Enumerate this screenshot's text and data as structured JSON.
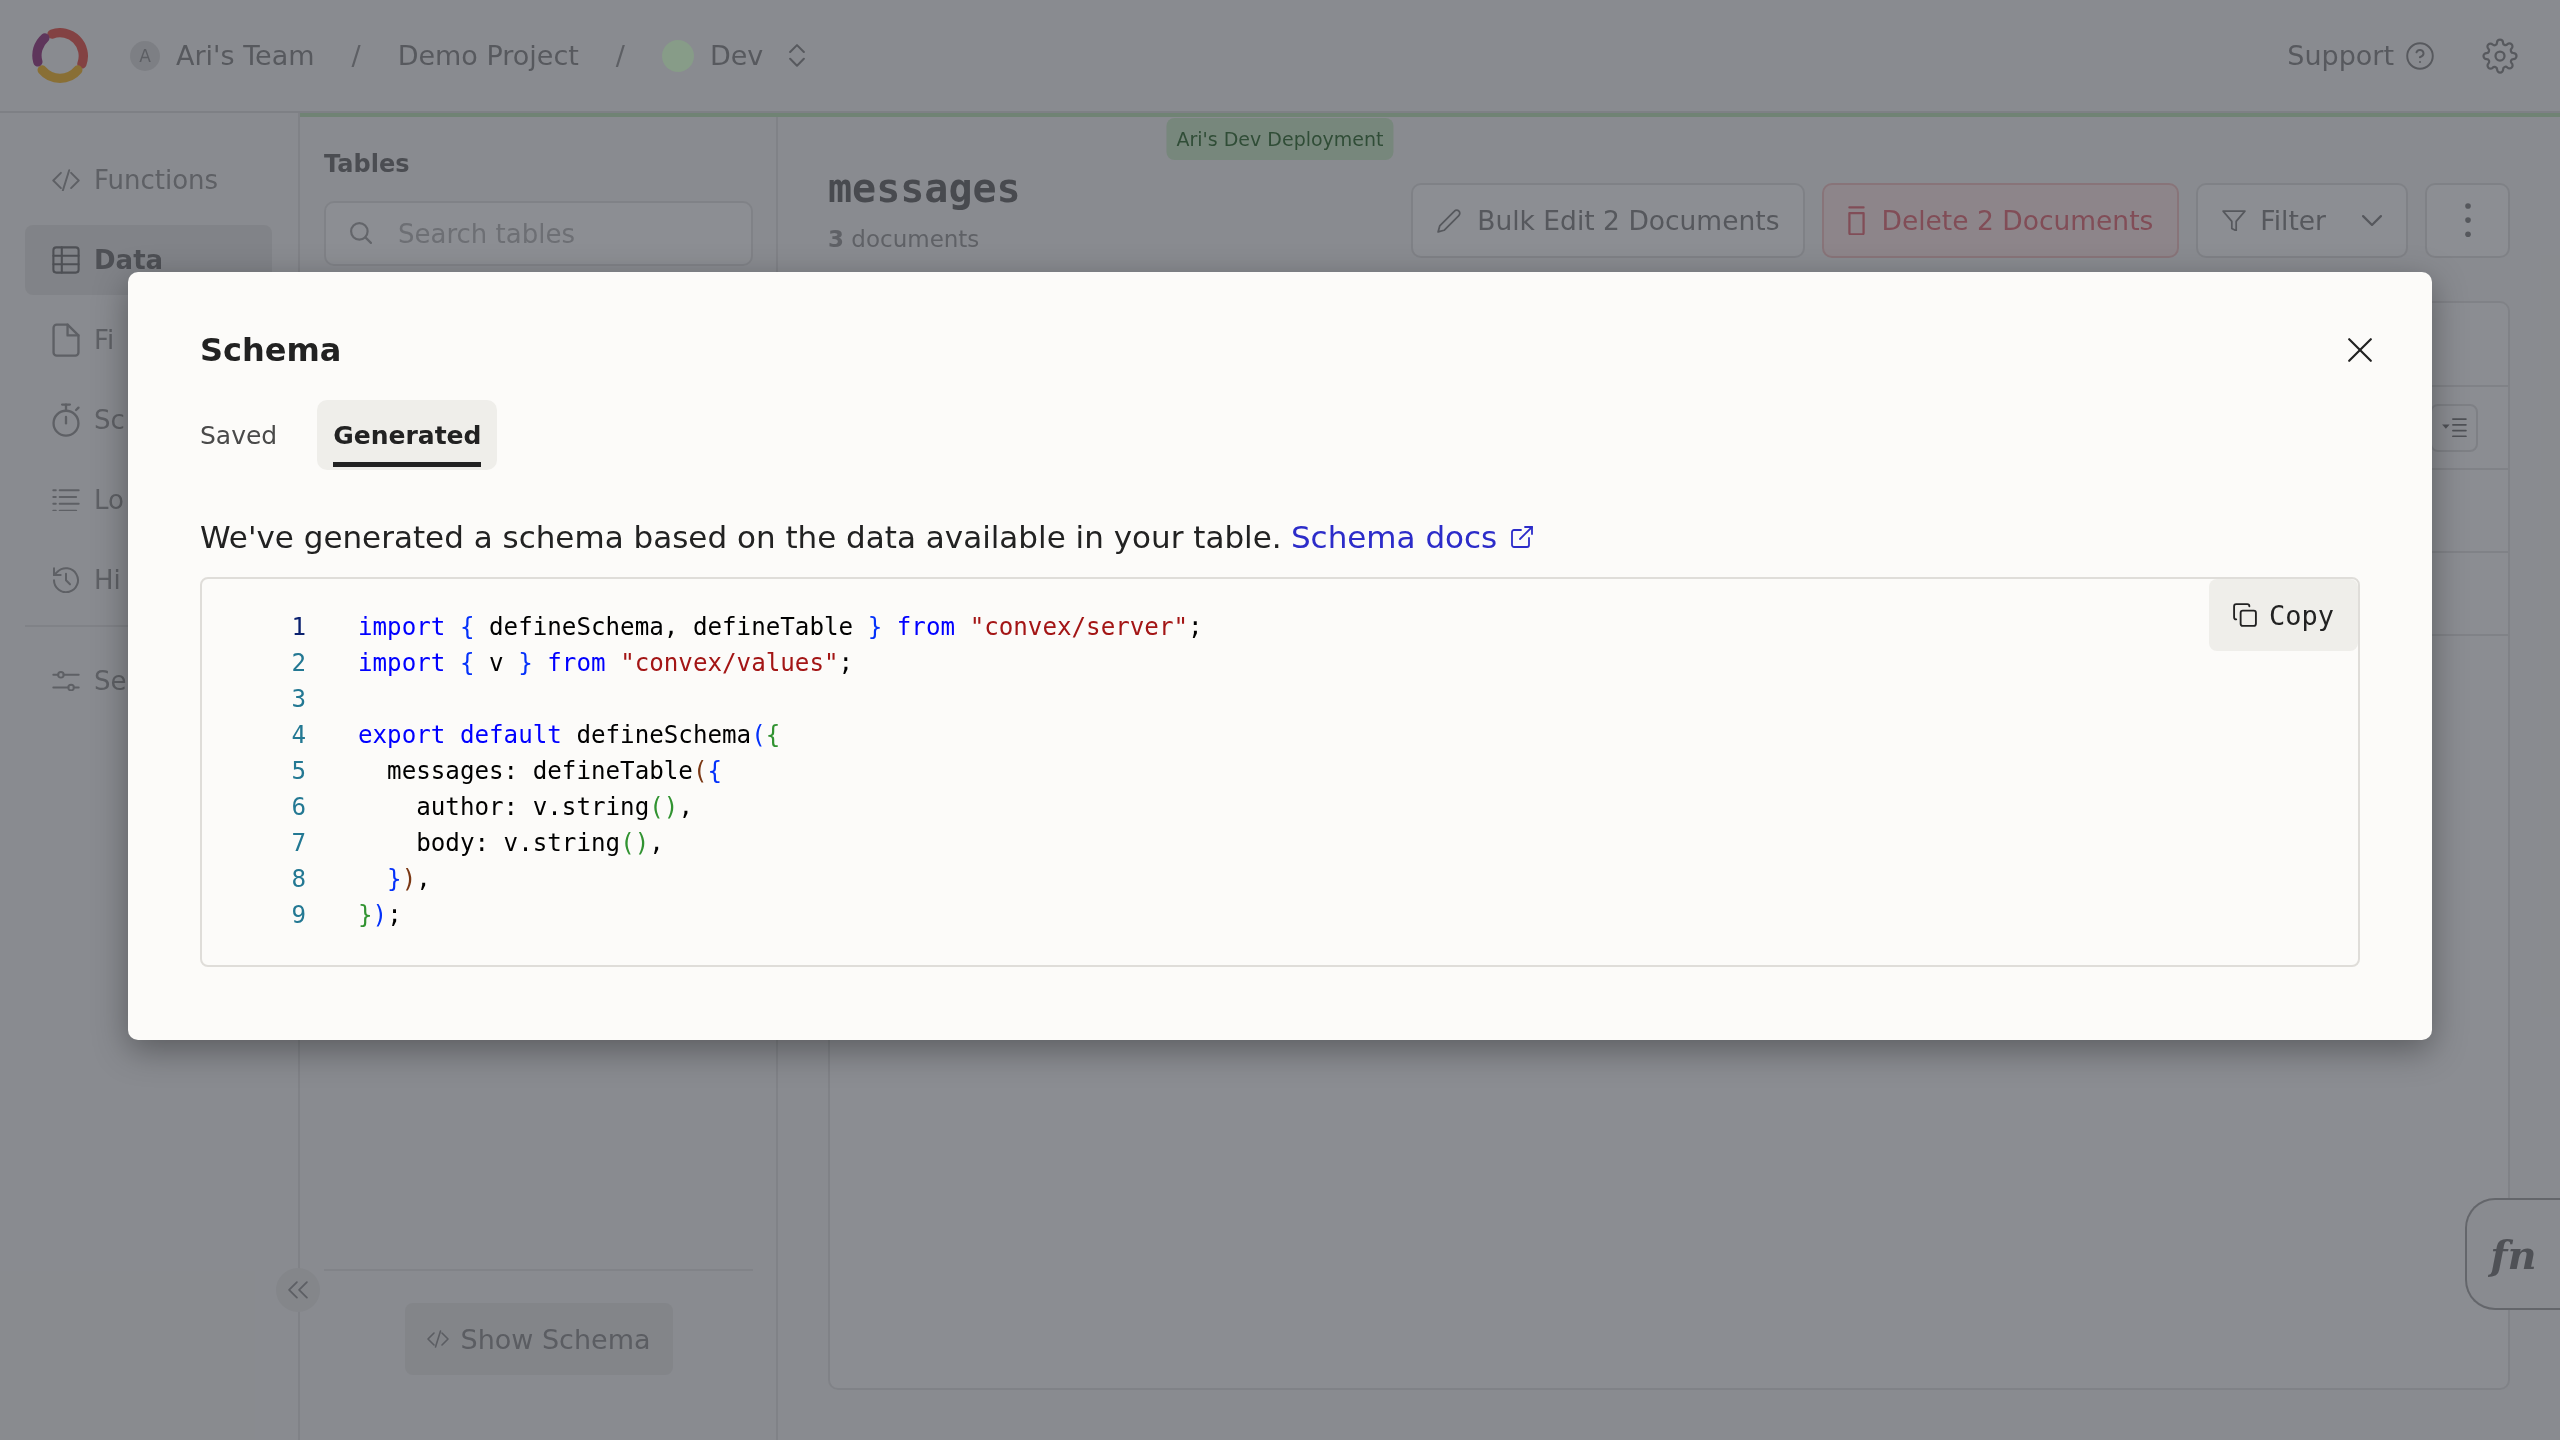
{
  "top_bar": {
    "breadcrumb": [
      {
        "kind": "team",
        "avatar": "A",
        "label": "Ari's Team"
      },
      {
        "kind": "separator",
        "label": "/"
      },
      {
        "kind": "project",
        "label": "Demo Project"
      },
      {
        "kind": "separator",
        "label": "/"
      },
      {
        "kind": "deployment",
        "label": "Dev",
        "color": "#879c88"
      }
    ],
    "support": "Support"
  },
  "deployment_badge": "Ari's Dev Deployment",
  "sidebar": {
    "sections": [
      {
        "items": [
          {
            "label": "Functions",
            "selected": false
          },
          {
            "label": "Data",
            "selected": true
          },
          {
            "label": "Fi",
            "selected": false
          },
          {
            "label": "Sc",
            "selected": false
          },
          {
            "label": "Lo",
            "selected": false
          },
          {
            "label": "Hi",
            "selected": false
          }
        ]
      },
      {
        "items": [
          {
            "label": "Se",
            "selected": false
          }
        ]
      }
    ]
  },
  "tables_panel": {
    "title": "Tables",
    "search": {
      "placeholder": "Search tables"
    },
    "show_schema_button": "Show Schema"
  },
  "table_header": {
    "title": "messages",
    "count": "**3** documents",
    "actions": [
      {
        "kind": "edit",
        "label": "Bulk Edit 2 Documents"
      },
      {
        "kind": "delete",
        "label": "Delete 2 Documents"
      },
      {
        "kind": "filter",
        "label": "Filter"
      },
      {
        "kind": "more"
      }
    ]
  },
  "function_runner_button": "fn",
  "modal": {
    "title": "Schema",
    "tabs": [
      {
        "label": "Saved",
        "selected": false
      },
      {
        "label": "Generated",
        "selected": true
      }
    ],
    "description": {
      "text": "We've generated a schema based on the data available in your table.",
      "link": "Schema docs"
    },
    "copy_button": "Copy",
    "code": [
      {
        "number": "1",
        "active": true,
        "tokens": [
          {
            "kind": "keyword",
            "text": "import "
          },
          {
            "kind": "bracket",
            "text": "{",
            "color": "#0431fa"
          },
          {
            "kind": "text",
            "text": " defineSchema, defineTable "
          },
          {
            "kind": "bracket",
            "text": "}",
            "color": "#0431fa"
          },
          {
            "kind": "keyword",
            "text": " from "
          },
          {
            "kind": "string",
            "text": "\"convex/server\""
          },
          {
            "kind": "text",
            "text": ";"
          }
        ]
      },
      {
        "number": "2",
        "active": false,
        "tokens": [
          {
            "kind": "keyword",
            "text": "import "
          },
          {
            "kind": "bracket",
            "text": "{",
            "color": "#0431fa"
          },
          {
            "kind": "text",
            "text": " v "
          },
          {
            "kind": "bracket",
            "text": "}",
            "color": "#0431fa"
          },
          {
            "kind": "keyword",
            "text": " from "
          },
          {
            "kind": "string",
            "text": "\"convex/values\""
          },
          {
            "kind": "text",
            "text": ";"
          }
        ]
      },
      {
        "number": "3",
        "active": false
      },
      {
        "number": "4",
        "active": false,
        "tokens": [
          {
            "kind": "keyword",
            "text": "export default"
          },
          {
            "kind": "text",
            "text": " defineSchema"
          },
          {
            "kind": "bracket",
            "text": "(",
            "color": "#0431fa"
          },
          {
            "kind": "bracket",
            "text": "{",
            "color": "#319331"
          }
        ]
      },
      {
        "number": "5",
        "active": false,
        "tokens": [
          {
            "kind": "text",
            "text": "  messages: defineTable"
          },
          {
            "kind": "bracket",
            "text": "(",
            "color": "#7b3814"
          },
          {
            "kind": "bracket",
            "text": "{",
            "color": "#0431fa"
          }
        ]
      },
      {
        "number": "6",
        "active": false,
        "tokens": [
          {
            "kind": "text",
            "text": "    author: v.string"
          },
          {
            "kind": "bracket",
            "text": "(",
            "color": "#319331"
          },
          {
            "kind": "bracket",
            "text": ")",
            "color": "#319331"
          },
          {
            "kind": "text",
            "text": ","
          }
        ]
      },
      {
        "number": "7",
        "active": false,
        "tokens": [
          {
            "kind": "text",
            "text": "    body: v.string"
          },
          {
            "kind": "bracket",
            "text": "(",
            "color": "#319331"
          },
          {
            "kind": "bracket",
            "text": ")",
            "color": "#319331"
          },
          {
            "kind": "text",
            "text": ","
          }
        ]
      },
      {
        "number": "8",
        "active": false,
        "tokens": [
          {
            "kind": "bracket",
            "text": "  }",
            "color": "#0431fa"
          },
          {
            "kind": "bracket",
            "text": ")",
            "color": "#7b3814"
          },
          {
            "kind": "text",
            "text": ","
          }
        ]
      },
      {
        "number": "9",
        "active": false,
        "tokens": [
          {
            "kind": "bracket",
            "text": "}",
            "color": "#319331"
          },
          {
            "kind": "bracket",
            "text": ")",
            "color": "#0431fa"
          },
          {
            "kind": "text",
            "text": ";"
          }
        ]
      }
    ]
  }
}
